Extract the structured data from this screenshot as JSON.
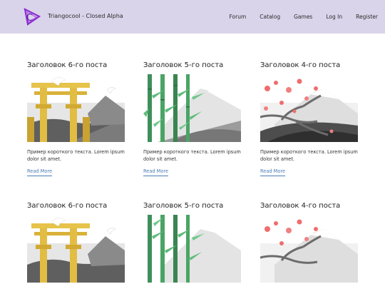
{
  "header": {
    "brand": "Triangocool - Closed Alpha",
    "logo_text": "TC",
    "nav": [
      "Forum",
      "Catalog",
      "Games",
      "Log In",
      "Register"
    ]
  },
  "posts": [
    {
      "title": "Заголовок 6-го поста",
      "excerpt": "Пример короткого текста. Lorem ipsum dolor sit amet.",
      "cta": "Read More",
      "image": "torii-gate"
    },
    {
      "title": "Заголовок 5-го поста",
      "excerpt": "Пример короткого текста. Lorem ipsum dolor sit amet.",
      "cta": "Read More",
      "image": "bamboo-mountain"
    },
    {
      "title": "Заголовок 4-го поста",
      "excerpt": "Пример короткого текста. Lorem ipsum dolor sit amet.",
      "cta": "Read More",
      "image": "sakura-fuji"
    },
    {
      "title": "Заголовок 6-го поста",
      "excerpt": "",
      "cta": "",
      "image": "torii-gate"
    },
    {
      "title": "Заголовок 5-го поста",
      "excerpt": "",
      "cta": "",
      "image": "bamboo-mountain"
    },
    {
      "title": "Заголовок 4-го поста",
      "excerpt": "",
      "cta": "",
      "image": "sakura-fuji"
    }
  ],
  "colors": {
    "header_bg": "#d9d4ea",
    "link": "#4b7cb6",
    "logo_purple": "#8b2fd1"
  }
}
